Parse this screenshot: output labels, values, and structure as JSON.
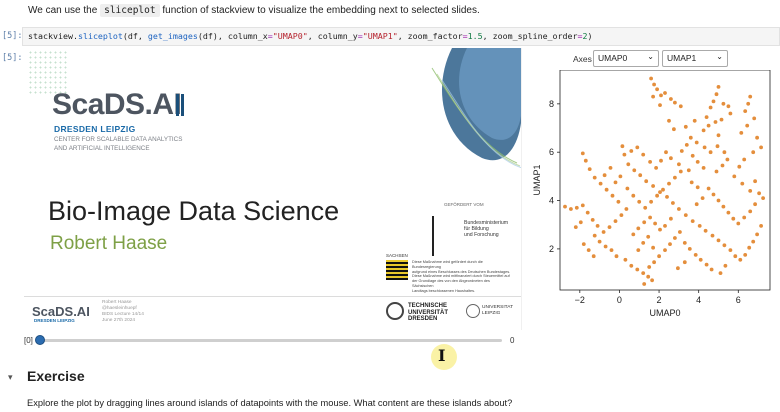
{
  "intro": {
    "before": "We can use the ",
    "code": "sliceplot",
    "after": " function of stackview to visualize the embedding next to selected slides."
  },
  "cells": {
    "input_prompt": "[5]:",
    "output_prompt": "[5]:",
    "code": {
      "t1": "stackview.",
      "t2": "sliceplot",
      "t3": "(df, ",
      "t4": "get_images",
      "t5": "(df), column_x",
      "t6": "=",
      "t7": "\"UMAP0\"",
      "t8": ", column_y",
      "t9": "=",
      "t10": "\"UMAP1\"",
      "t11": ", zoom_factor",
      "t12": "=",
      "t13": "1.5",
      "t14": ", zoom_spline_order",
      "t15": "=",
      "t16": "2",
      "t17": ")"
    }
  },
  "slide": {
    "logo_text": "ScaDS.AI",
    "logo_city": "DRESDEN LEIPZIG",
    "logo_sub_1": "CENTER FOR SCALABLE DATA ANALYTICS",
    "logo_sub_2": "AND ARTIFICIAL INTELLIGENCE",
    "title": "Bio-Image Data Science",
    "author": "Robert Haase",
    "gov_top": "GEFÖRDERT VOM",
    "gov_1": "Bundesministerium",
    "gov_2": "für Bildung",
    "gov_3": "und Forschung",
    "saxony_head": "SACHSEN",
    "saxony_1": "Diese Maßnahme wird gefördert durch die Bundesregierung",
    "saxony_2": "aufgrund eines Beschlusses des Deutschen Bundestages.",
    "saxony_3": "Diese Maßnahme wird mitfinanziert durch Steuermittel auf",
    "saxony_4": "der Grundlage des von den Abgeordneten des Sächsischen",
    "saxony_5": "Landtags beschlossenen Haushaltes.",
    "foot_logo": "ScaDS.AI",
    "foot_city": "DRESDEN LEIPZIG",
    "foot_name": "Robert Haase",
    "foot_handle": "@haesleinhuepf",
    "foot_course": "BIDS Lecture 14/14",
    "foot_date": "June 27th 2024",
    "tud_1": "TECHNISCHE",
    "tud_2": "UNIVERSITÄT",
    "tud_3": "DRESDEN",
    "uni_1": "UNIVERSITAT",
    "uni_2": "LEIPZIG"
  },
  "slider": {
    "index_label": "[0]",
    "value": "0",
    "fraction": 0.0
  },
  "axes": {
    "label": "Axes",
    "x_select": "UMAP0",
    "y_select": "UMAP1"
  },
  "colors": {
    "points": "#e48e3c",
    "slider": "#2b6cb0"
  },
  "chart_data": {
    "type": "scatter",
    "xlabel": "UMAP0",
    "ylabel": "UMAP1",
    "xlim": [
      -3.0,
      7.6
    ],
    "ylim": [
      0.3,
      9.4
    ],
    "xticks": [
      "−2",
      "0",
      "2",
      "4",
      "6"
    ],
    "yticks": [
      "2",
      "4",
      "6",
      "8"
    ],
    "series": [
      {
        "points": [
          [
            1.6,
            9.05
          ],
          [
            1.75,
            8.8
          ],
          [
            1.9,
            8.6
          ],
          [
            2.1,
            8.35
          ],
          [
            2.3,
            8.45
          ],
          [
            2.6,
            8.2
          ],
          [
            2.8,
            8.05
          ],
          [
            3.1,
            7.9
          ],
          [
            2.05,
            7.95
          ],
          [
            1.7,
            8.3
          ],
          [
            5.0,
            8.7
          ],
          [
            4.9,
            8.4
          ],
          [
            4.75,
            8.1
          ],
          [
            4.6,
            7.85
          ],
          [
            5.25,
            8.0
          ],
          [
            5.5,
            7.9
          ],
          [
            5.6,
            7.6
          ],
          [
            4.4,
            7.45
          ],
          [
            4.5,
            7.1
          ],
          [
            4.85,
            7.25
          ],
          [
            5.15,
            7.35
          ],
          [
            4.25,
            6.9
          ],
          [
            5.0,
            6.7
          ],
          [
            6.6,
            8.3
          ],
          [
            6.5,
            8.0
          ],
          [
            6.35,
            7.7
          ],
          [
            6.8,
            7.4
          ],
          [
            6.45,
            7.1
          ],
          [
            6.15,
            6.8
          ],
          [
            6.95,
            6.6
          ],
          [
            7.15,
            6.2
          ],
          [
            6.75,
            6.0
          ],
          [
            6.3,
            5.7
          ],
          [
            6.05,
            5.4
          ],
          [
            5.8,
            5.0
          ],
          [
            6.2,
            4.7
          ],
          [
            6.6,
            4.4
          ],
          [
            6.85,
            4.8
          ],
          [
            7.05,
            4.3
          ],
          [
            7.25,
            4.1
          ],
          [
            3.6,
            6.6
          ],
          [
            3.4,
            6.3
          ],
          [
            3.15,
            6.05
          ],
          [
            3.7,
            5.85
          ],
          [
            3.95,
            5.6
          ],
          [
            4.25,
            5.35
          ],
          [
            3.5,
            5.25
          ],
          [
            3.0,
            5.5
          ],
          [
            2.6,
            5.75
          ],
          [
            2.35,
            6.0
          ],
          [
            2.1,
            5.65
          ],
          [
            1.85,
            5.35
          ],
          [
            1.55,
            5.6
          ],
          [
            1.2,
            5.9
          ],
          [
            0.9,
            6.2
          ],
          [
            0.6,
            6.05
          ],
          [
            0.15,
            6.25
          ],
          [
            0.25,
            5.9
          ],
          [
            0.45,
            5.5
          ],
          [
            0.75,
            5.25
          ],
          [
            1.05,
            5.05
          ],
          [
            1.35,
            4.8
          ],
          [
            1.7,
            4.6
          ],
          [
            2.05,
            4.35
          ],
          [
            2.4,
            4.15
          ],
          [
            2.7,
            3.9
          ],
          [
            3.0,
            3.65
          ],
          [
            3.35,
            3.4
          ],
          [
            3.7,
            3.15
          ],
          [
            4.05,
            2.95
          ],
          [
            4.35,
            2.75
          ],
          [
            4.7,
            2.55
          ],
          [
            5.0,
            2.35
          ],
          [
            5.3,
            2.15
          ],
          [
            5.6,
            1.95
          ],
          [
            5.85,
            1.7
          ],
          [
            6.1,
            1.55
          ],
          [
            6.35,
            1.75
          ],
          [
            6.55,
            2.05
          ],
          [
            6.75,
            2.3
          ],
          [
            6.95,
            2.6
          ],
          [
            7.15,
            2.95
          ],
          [
            -1.85,
            3.8
          ],
          [
            -2.15,
            3.7
          ],
          [
            -2.45,
            3.65
          ],
          [
            -2.75,
            3.75
          ],
          [
            -1.6,
            3.5
          ],
          [
            -1.35,
            3.2
          ],
          [
            -1.1,
            2.95
          ],
          [
            -0.8,
            2.7
          ],
          [
            -0.5,
            2.9
          ],
          [
            -0.2,
            3.15
          ],
          [
            0.1,
            3.4
          ],
          [
            0.35,
            3.65
          ],
          [
            -0.05,
            3.95
          ],
          [
            -0.35,
            4.2
          ],
          [
            -0.65,
            4.45
          ],
          [
            -0.95,
            4.7
          ],
          [
            -1.25,
            4.95
          ],
          [
            -1.5,
            5.3
          ],
          [
            -1.7,
            5.65
          ],
          [
            -1.85,
            5.95
          ],
          [
            -1.25,
            2.55
          ],
          [
            -1.0,
            2.3
          ],
          [
            -0.7,
            2.1
          ],
          [
            -0.4,
            1.95
          ],
          [
            -0.15,
            1.7
          ],
          [
            -1.8,
            2.2
          ],
          [
            -1.55,
            1.95
          ],
          [
            -1.3,
            1.7
          ],
          [
            0.3,
            1.55
          ],
          [
            0.6,
            1.3
          ],
          [
            0.9,
            1.15
          ],
          [
            1.2,
            1.0
          ],
          [
            1.45,
            0.85
          ],
          [
            1.65,
            0.7
          ],
          [
            1.25,
            0.55
          ],
          [
            1.5,
            1.25
          ],
          [
            1.75,
            1.45
          ],
          [
            2.0,
            1.7
          ],
          [
            2.3,
            1.95
          ],
          [
            2.55,
            2.2
          ],
          [
            2.8,
            2.45
          ],
          [
            3.05,
            2.7
          ],
          [
            3.3,
            2.25
          ],
          [
            3.55,
            2.0
          ],
          [
            3.85,
            1.75
          ],
          [
            4.1,
            1.55
          ],
          [
            4.4,
            1.35
          ],
          [
            4.65,
            1.15
          ],
          [
            0.7,
            2.6
          ],
          [
            0.95,
            2.85
          ],
          [
            1.25,
            3.1
          ],
          [
            1.55,
            3.3
          ],
          [
            1.8,
            3.05
          ],
          [
            2.05,
            2.8
          ],
          [
            0.4,
            4.5
          ],
          [
            0.7,
            4.2
          ],
          [
            1.0,
            3.95
          ],
          [
            1.3,
            3.7
          ],
          [
            1.6,
            3.95
          ],
          [
            1.9,
            4.2
          ],
          [
            2.2,
            4.45
          ],
          [
            2.5,
            4.7
          ],
          [
            2.8,
            4.95
          ],
          [
            3.1,
            5.2
          ],
          [
            4.5,
            4.5
          ],
          [
            4.75,
            4.25
          ],
          [
            5.0,
            4.0
          ],
          [
            5.25,
            3.75
          ],
          [
            5.5,
            3.5
          ],
          [
            5.75,
            3.25
          ],
          [
            4.9,
            5.2
          ],
          [
            5.2,
            5.45
          ],
          [
            5.45,
            5.7
          ],
          [
            5.3,
            6.0
          ],
          [
            4.95,
            6.25
          ],
          [
            4.6,
            6.0
          ],
          [
            4.3,
            6.2
          ],
          [
            3.9,
            6.4
          ],
          [
            2.75,
            6.95
          ],
          [
            2.5,
            7.3
          ],
          [
            3.35,
            7.05
          ],
          [
            3.8,
            7.3
          ],
          [
            -0.45,
            5.35
          ],
          [
            -0.75,
            5.05
          ],
          [
            -0.2,
            4.75
          ],
          [
            0.05,
            5.0
          ],
          [
            2.3,
            2.95
          ],
          [
            2.6,
            3.25
          ],
          [
            3.9,
            3.85
          ],
          [
            4.2,
            4.1
          ],
          [
            3.95,
            4.55
          ],
          [
            3.65,
            4.75
          ],
          [
            6.0,
            3.05
          ],
          [
            6.3,
            3.3
          ],
          [
            6.6,
            3.55
          ],
          [
            6.85,
            3.85
          ],
          [
            -2.2,
            2.9
          ],
          [
            -1.95,
            3.1
          ],
          [
            0.95,
            1.95
          ],
          [
            1.2,
            2.25
          ],
          [
            1.45,
            2.5
          ],
          [
            1.7,
            2.05
          ],
          [
            5.1,
            1.0
          ],
          [
            5.35,
            1.3
          ],
          [
            3.3,
            1.45
          ],
          [
            2.95,
            1.2
          ]
        ]
      }
    ]
  }
}
